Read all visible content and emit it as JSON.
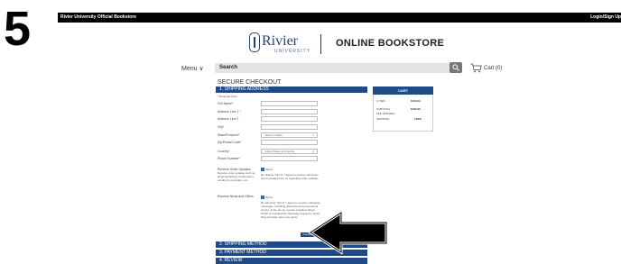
{
  "step_number": "5",
  "topbar": {
    "brand": "Rivier University Official Bookstore",
    "login": "Login/Sign Up"
  },
  "logo": {
    "name": "Rivier",
    "sub": "UNIVERSITY",
    "store": "ONLINE BOOKSTORE"
  },
  "nav": {
    "menu": "Menu",
    "search_placeholder": "Search",
    "cart": "Cart (0)"
  },
  "checkout": {
    "title": "SECURE CHECKOUT",
    "section1": "1. SHIPPING ADDRESS",
    "required_note": "* Required Field",
    "fields": [
      {
        "label": "Full Name*",
        "value": ""
      },
      {
        "label": "Address Line 1 *",
        "value": ""
      },
      {
        "label": "Address Line 2",
        "value": ""
      },
      {
        "label": "City*",
        "value": ""
      },
      {
        "label": "State/Province*",
        "value": "-Select a State-"
      },
      {
        "label": "Zip/Postal Code*",
        "value": ""
      },
      {
        "label": "Country*",
        "value": "United States of America"
      },
      {
        "label": "Phone Number*",
        "value": ""
      }
    ],
    "order_updates": {
      "label": "Receive Order Updates",
      "desc": "Receive order updates such as shipping/delivery confirmation, email/sms reminders, etc.",
      "opt": "Opt In",
      "text": "By clicking \"Opt In\" I agree to receive call phone text messages from us regarding order updates."
    },
    "news_offers": {
      "label": "Receive News and Offers",
      "opt": "Opt In",
      "text": "By selecting \"Opt In\" I agree to receive marketing messages, including discounts and promotional events, at the phone number provided. Reply STOP to unsubscribe. Message frequency varies. Msg and data rates may apply."
    },
    "continue": "Continue",
    "section2": "2. SHIPPING METHOD",
    "section3": "3. PAYMENT METHOD",
    "section4": "4. REVIEW"
  },
  "cart_summary": {
    "title": "CART",
    "rows": [
      {
        "label": "1 ITEM",
        "value": "$189.99"
      },
      {
        "label": "SUBTOTAL",
        "value": "$189.99"
      },
      {
        "label": "FEE (WAIVED)",
        "value": ""
      },
      {
        "label": "SHIPPING",
        "value": "FREE"
      }
    ]
  },
  "colors": {
    "accent": "#1e4a86",
    "topbar": "#000000",
    "search_bg": "#e4e4e4"
  }
}
